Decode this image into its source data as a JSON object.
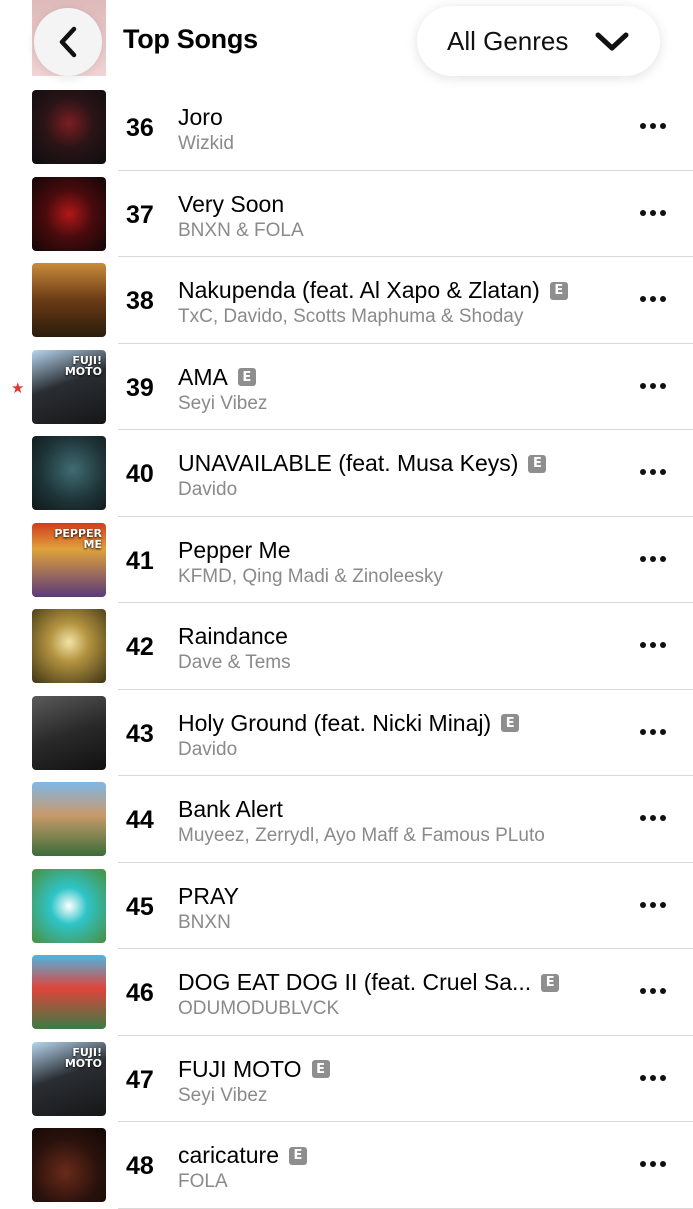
{
  "header": {
    "title": "Top Songs",
    "genre_selector": "All Genres",
    "back_icon": "chevron-left-icon",
    "dropdown_icon": "chevron-down-icon"
  },
  "colors": {
    "explicit_badge": "#8e8e8e",
    "star": "#e0372f",
    "artist_text": "#8a8a8a"
  },
  "songs": [
    {
      "rank": "36",
      "title": "Joro",
      "artist": "Wizkid",
      "explicit": false
    },
    {
      "rank": "37",
      "title": "Very Soon",
      "artist": "BNXN & FOLA",
      "explicit": false
    },
    {
      "rank": "38",
      "title": "Nakupenda (feat. Al Xapo & Zlatan)",
      "artist": "TxC, Davido, Scotts Maphuma & Shoday",
      "explicit": true
    },
    {
      "rank": "39",
      "title": "AMA",
      "artist": "Seyi Vibez",
      "explicit": true,
      "starred": true,
      "cover_text": "FUJI! MOTO"
    },
    {
      "rank": "40",
      "title": "UNAVAILABLE (feat. Musa Keys)",
      "artist": "Davido",
      "explicit": true
    },
    {
      "rank": "41",
      "title": "Pepper Me",
      "artist": "KFMD, Qing Madi & Zinoleesky",
      "explicit": false,
      "cover_text": "PEPPER ME"
    },
    {
      "rank": "42",
      "title": "Raindance",
      "artist": "Dave & Tems",
      "explicit": false
    },
    {
      "rank": "43",
      "title": "Holy Ground (feat. Nicki Minaj)",
      "artist": "Davido",
      "explicit": true
    },
    {
      "rank": "44",
      "title": "Bank Alert",
      "artist": "Muyeez, Zerrydl, Ayo Maff & Famous PLuto",
      "explicit": false
    },
    {
      "rank": "45",
      "title": "PRAY",
      "artist": "BNXN",
      "explicit": false
    },
    {
      "rank": "46",
      "title": "DOG EAT DOG II (feat. Cruel Sa...",
      "artist": "ODUMODUBLVCK",
      "explicit": true
    },
    {
      "rank": "47",
      "title": "FUJI MOTO",
      "artist": "Seyi Vibez",
      "explicit": true,
      "cover_text": "FUJI! MOTO"
    },
    {
      "rank": "48",
      "title": "caricature",
      "artist": "FOLA",
      "explicit": true
    }
  ],
  "explicit_label": "E"
}
